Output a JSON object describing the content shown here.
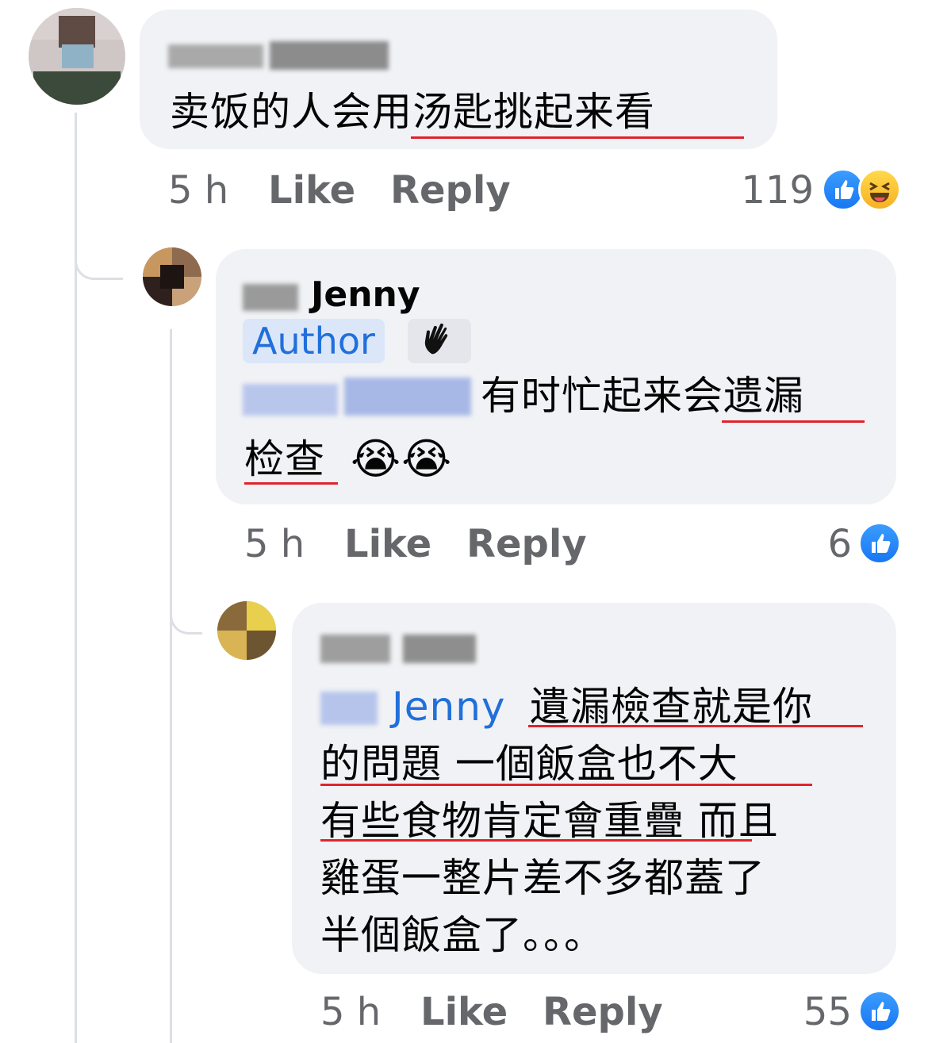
{
  "comments": [
    {
      "text": "卖饭的人会用汤匙挑起来看",
      "time": "5 h",
      "like_label": "Like",
      "reply_label": "Reply",
      "reaction_count": "119",
      "reactions": [
        "like-icon",
        "haha-icon"
      ]
    },
    {
      "author": "Jenny",
      "author_badge": "Author",
      "text_line1": "有时忙起来会遗漏",
      "text_line2": "检查",
      "emoji": "😭😭",
      "time": "5 h",
      "like_label": "Like",
      "reply_label": "Reply",
      "reaction_count": "6",
      "reactions": [
        "like-icon"
      ]
    },
    {
      "mention": "Jenny",
      "text_line1": "遺漏檢查就是你",
      "text_line2": "的問題 一個飯盒也不大",
      "text_line3": "有些食物肯定會重疊 而且",
      "text_line4": "雞蛋一整片差不多都蓋了",
      "text_line5": "半個飯盒了。。。",
      "time": "5 h",
      "like_label": "Like",
      "reply_label": "Reply",
      "reaction_count": "55",
      "reactions": [
        "like-icon"
      ]
    }
  ],
  "colors": {
    "bubble": "#f0f2f5",
    "link": "#216fdb",
    "meta": "#65676b",
    "underline": "#e0242a"
  }
}
